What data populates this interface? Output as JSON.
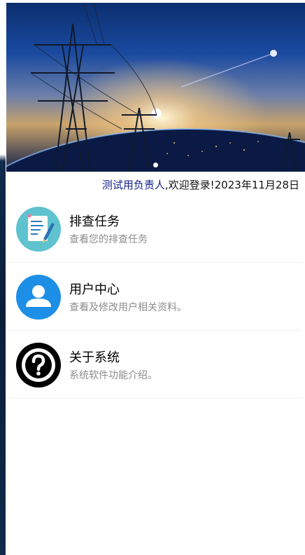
{
  "banner": {
    "image": "power-transmission-towers-over-earth-at-night",
    "indicator_count": 1
  },
  "welcome": {
    "user": "测试用负责人",
    "message": ",欢迎登录!",
    "date": "2023年11月28日"
  },
  "menu": {
    "items": [
      {
        "icon": "task-document-pen-icon",
        "title": "排查任务",
        "desc": "查看您的排查任务"
      },
      {
        "icon": "user-profile-icon",
        "title": "用户中心",
        "desc": "查看及修改用户相关资料。"
      },
      {
        "icon": "question-mark-icon",
        "title": "关于系统",
        "desc": "系统软件功能介绍。"
      }
    ]
  },
  "colors": {
    "user_name": "#16238a",
    "task_icon_bg": "#5ec3cf",
    "user_icon_bg": "#1e8fe6",
    "about_icon_bg": "#000000",
    "desc_text": "#8c8c8c"
  }
}
